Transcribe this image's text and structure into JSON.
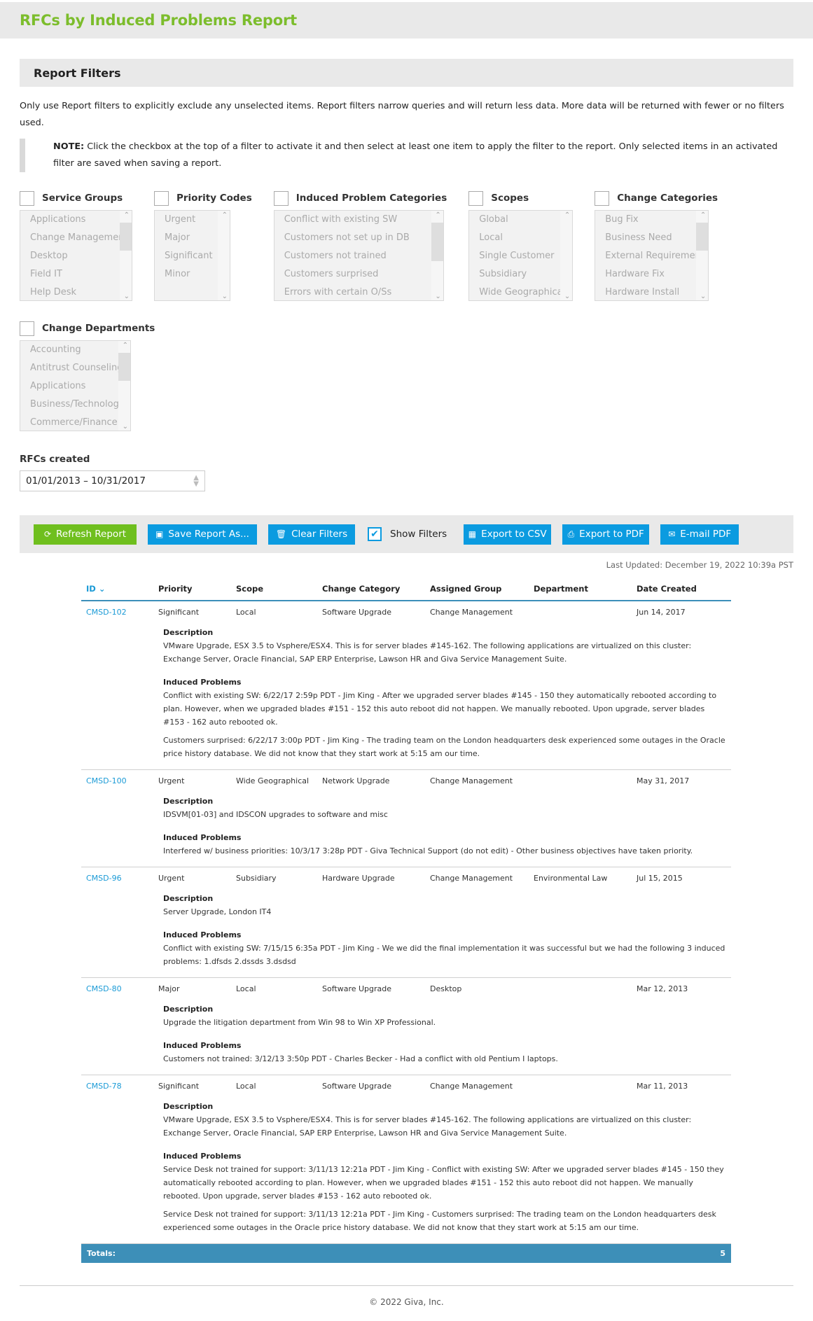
{
  "page": {
    "title": "RFCs by Induced Problems Report"
  },
  "filters_section": {
    "title": "Report Filters",
    "intro": "Only use Report filters to explicitly exclude any unselected items. Report filters narrow queries and will return less data. More data will be returned with fewer or no filters used.",
    "note_label": "NOTE:",
    "note_text": " Click the checkbox at the top of a filter to activate it and then select at least one item to apply the filter to the report. Only selected items in an activated filter are saved when saving a report."
  },
  "filters": [
    {
      "label": "Service Groups",
      "checked": false,
      "items": [
        "Applications",
        "Change Management",
        "Desktop",
        "Field IT",
        "Help Desk"
      ]
    },
    {
      "label": "Priority Codes",
      "checked": false,
      "items": [
        "Urgent",
        "Major",
        "Significant",
        "Minor"
      ]
    },
    {
      "label": "Induced Problem Categories",
      "checked": false,
      "items": [
        "Conflict with existing SW",
        "Customers not set up in DB",
        "Customers not trained",
        "Customers surprised",
        "Errors with certain O/Ss"
      ]
    },
    {
      "label": "Scopes",
      "checked": false,
      "items": [
        "Global",
        "Local",
        "Single Customer",
        "Subsidiary",
        "Wide Geographical"
      ]
    },
    {
      "label": "Change Categories",
      "checked": false,
      "items": [
        "Bug Fix",
        "Business Need",
        "External Requirement",
        "Hardware Fix",
        "Hardware Install"
      ]
    },
    {
      "label": "Change Departments",
      "checked": false,
      "items": [
        "Accounting",
        "Antitrust Counseling",
        "Applications",
        "Business/Technology",
        "Commerce/Finance"
      ]
    }
  ],
  "date_filter": {
    "label": "RFCs created",
    "value": "01/01/2013 – 10/31/2017"
  },
  "toolbar": {
    "refresh": "Refresh Report",
    "save_as": "Save Report As...",
    "clear": "Clear Filters",
    "show_filters": "Show Filters",
    "show_filters_checked": true,
    "export_csv": "Export to CSV",
    "export_pdf": "Export to PDF",
    "email_pdf": "E-mail PDF"
  },
  "last_updated": "Last Updated: December 19, 2022 10:39a PST",
  "table": {
    "columns": [
      "ID",
      "Priority",
      "Scope",
      "Change Category",
      "Assigned Group",
      "Department",
      "Date Created"
    ],
    "sort_column": "ID",
    "sort_direction": "descending",
    "description_label": "Description",
    "induced_label": "Induced Problems",
    "rows": [
      {
        "id": "CMSD-102",
        "priority": "Significant",
        "scope": "Local",
        "category": "Software Upgrade",
        "group": "Change Management",
        "department": "",
        "date": "Jun 14, 2017",
        "description": "VMware Upgrade, ESX 3.5 to Vsphere/ESX4. This is for server blades #145-162. The following applications are virtualized on this cluster: Exchange Server, Oracle Financial, SAP ERP Enterprise, Lawson HR and Giva Service Management Suite.",
        "induced": [
          "Conflict with existing SW: 6/22/17 2:59p PDT - Jim King - After we upgraded server blades #145 - 150 they automatically rebooted according to plan. However, when we upgraded blades #151 - 152 this auto reboot did not happen. We manually rebooted. Upon upgrade, server blades #153 - 162 auto rebooted ok.",
          "Customers surprised: 6/22/17 3:00p PDT - Jim King - The trading team on the London headquarters desk experienced some outages in the Oracle price history database. We did not know that they start work at 5:15 am our time."
        ]
      },
      {
        "id": "CMSD-100",
        "priority": "Urgent",
        "scope": "Wide Geographical",
        "category": "Network Upgrade",
        "group": "Change Management",
        "department": "",
        "date": "May 31, 2017",
        "description": "IDSVM[01-03] and IDSCON upgrades to software and misc",
        "induced": [
          "Interfered w/ business priorities: 10/3/17 3:28p PDT - Giva Technical Support (do not edit) - Other business objectives have taken priority."
        ]
      },
      {
        "id": "CMSD-96",
        "priority": "Urgent",
        "scope": "Subsidiary",
        "category": "Hardware Upgrade",
        "group": "Change Management",
        "department": "Environmental Law",
        "date": "Jul 15, 2015",
        "description": "Server Upgrade, London IT4",
        "induced": [
          "Conflict with existing SW: 7/15/15 6:35a PDT - Jim King - We we did the final implementation it was successful but we had the following 3 induced problems: 1.dfsds 2.dssds 3.dsdsd"
        ]
      },
      {
        "id": "CMSD-80",
        "priority": "Major",
        "scope": "Local",
        "category": "Software Upgrade",
        "group": "Desktop",
        "department": "",
        "date": "Mar 12, 2013",
        "description": "Upgrade the litigation department from Win 98 to Win XP Professional.",
        "induced": [
          "Customers not trained: 3/12/13 3:50p PDT - Charles Becker - Had a conflict with old Pentium I laptops."
        ]
      },
      {
        "id": "CMSD-78",
        "priority": "Significant",
        "scope": "Local",
        "category": "Software Upgrade",
        "group": "Change Management",
        "department": "",
        "date": "Mar 11, 2013",
        "description": "VMware Upgrade, ESX 3.5 to Vsphere/ESX4. This is for server blades #145-162. The following applications are virtualized on this cluster: Exchange Server, Oracle Financial, SAP ERP Enterprise, Lawson HR and Giva Service Management Suite.",
        "induced": [
          "Service Desk not trained for support: 3/11/13 12:21a PDT - Jim King - Conflict with existing SW: After we upgraded server blades #145 - 150 they automatically rebooted according to plan. However, when we upgraded blades #151 - 152 this auto reboot did not happen. We manually rebooted. Upon upgrade, server blades #153 - 162 auto rebooted ok.",
          "Service Desk not trained for support: 3/11/13 12:21a PDT - Jim King - Customers surprised: The trading team on the London headquarters desk experienced some outages in the Oracle price history database. We did not know that they start work at 5:15 am our time."
        ]
      }
    ],
    "totals_label": "Totals:",
    "totals_value": "5"
  },
  "footer": {
    "copyright": "© 2022 Giva, Inc."
  },
  "colors": {
    "brand_green": "#7cbd2c",
    "button_blue": "#0b9be0",
    "button_green": "#6fbf1e",
    "link_blue": "#1a9ad6",
    "totals_bar": "#3d8fb8"
  }
}
